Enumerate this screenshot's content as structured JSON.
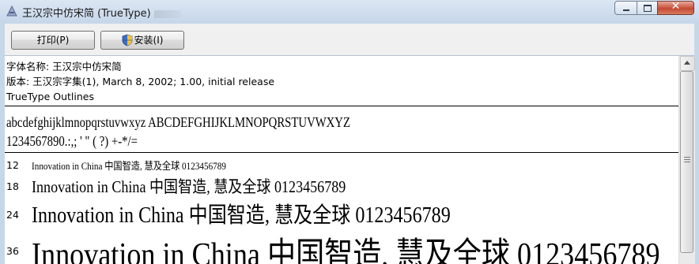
{
  "window": {
    "title": "王汉宗中仿宋简 (TrueType)",
    "close_glyph": "✕",
    "accent": "#c44b34"
  },
  "toolbar": {
    "print_label": "打印(P)",
    "install_label": "安装(I)"
  },
  "info": {
    "font_name": "字体名称: 王汉宗中仿宋简",
    "version": "版本: 王汉宗字集(1), March 8, 2002; 1.00, initial release",
    "outline_type": "TrueType Outlines"
  },
  "charset": {
    "letters": "abcdefghijklmnopqrstuvwxyz  ABCDEFGHIJKLMNOPQRSTUVWXYZ",
    "digits_punct": "1234567890.:,; ' \" ( ?)  +-*/="
  },
  "samples": [
    {
      "size": "12",
      "text": "Innovation in China 中国智造, 慧及全球 0123456789"
    },
    {
      "size": "18",
      "text": "Innovation in China 中国智造, 慧及全球 0123456789"
    },
    {
      "size": "24",
      "text": "Innovation in China 中国智造, 慧及全球 0123456789"
    },
    {
      "size": "36",
      "text": "Innovation in China 中国智造, 慧及全球 0123456789"
    }
  ],
  "icons": {
    "app": "font-viewer-icon",
    "install": "uac-shield-icon"
  }
}
